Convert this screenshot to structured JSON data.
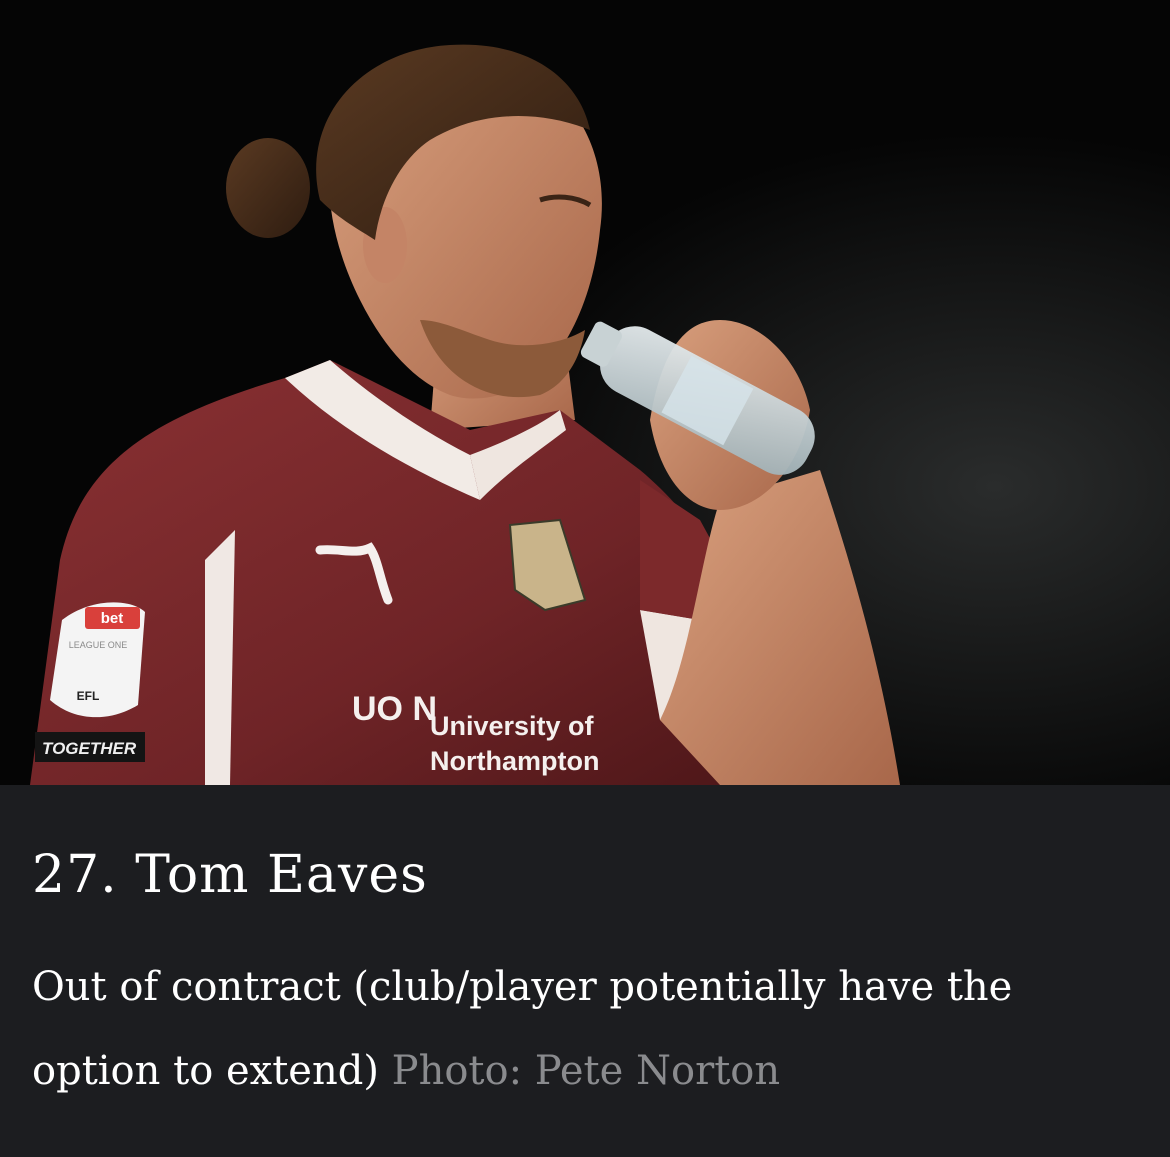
{
  "article_card": {
    "photo_alt": "Tom Eaves drinking from a water bottle",
    "jersey_text": {
      "sponsor_line1": "University of",
      "sponsor_line2": "Northampton",
      "sponsor_logo": "UO N",
      "sleeve_badge_top": "bet",
      "sleeve_badge_mid": "LEAGUE ONE",
      "sleeve_badge_bottom": "EFL",
      "sleeve_band": "TOGETHER"
    },
    "title": "27. Tom Eaves",
    "description": "Out of contract (club/player potentially have the option to extend)",
    "photo_credit": "Photo: Pete Norton"
  },
  "colors": {
    "caption_bg": "#1c1d20",
    "title_text": "#ffffff",
    "credit_text": "#8a8b8e",
    "jersey_maroon": "#7a2a2c"
  }
}
